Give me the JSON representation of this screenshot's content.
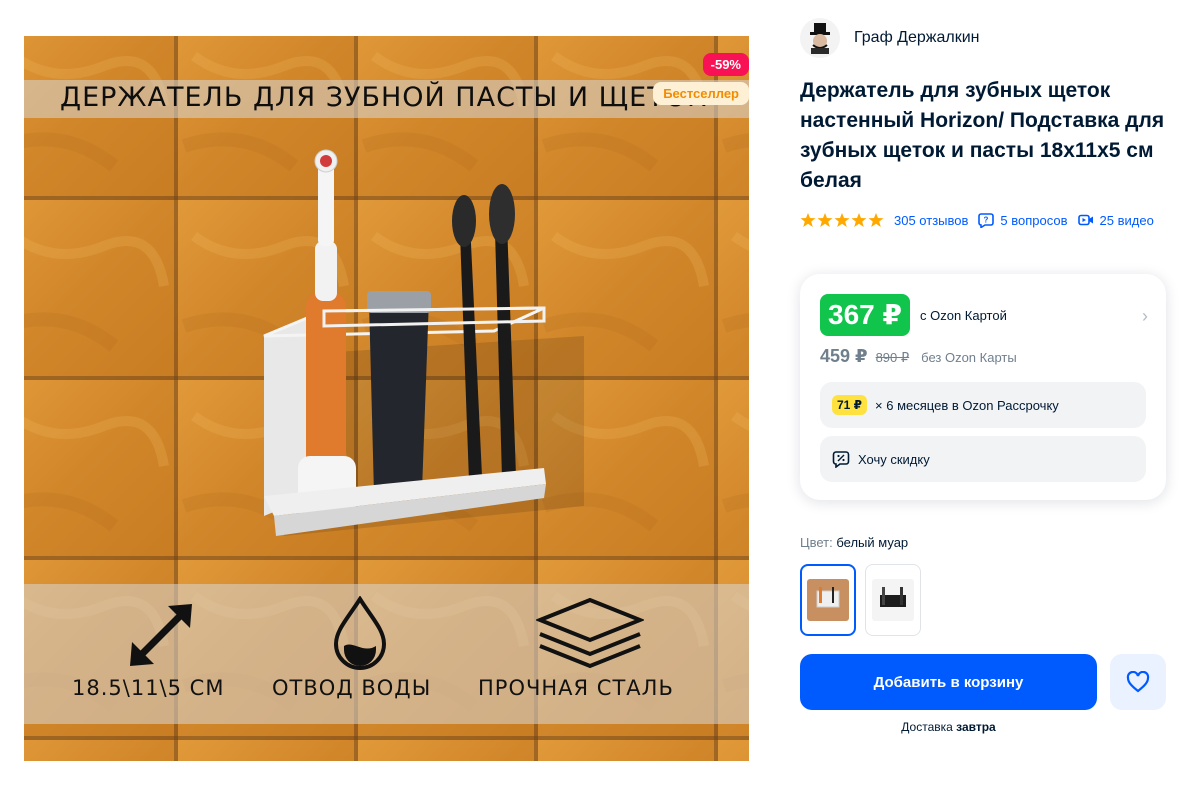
{
  "gallery": {
    "discount_badge": "-59%",
    "bestseller_badge": "Бестселлер",
    "image_title": "ДЕРЖАТЕЛЬ ДЛЯ ЗУБНОЙ ПАСТЫ И ЩЕТОК",
    "features": [
      {
        "label": "18.5\\11\\5 СМ",
        "icon": "diagonal-arrows-icon"
      },
      {
        "label": "ОТВОД ВОДЫ",
        "icon": "water-drop-icon"
      },
      {
        "label": "ПРОЧНАЯ СТАЛЬ",
        "icon": "steel-layers-icon"
      }
    ]
  },
  "seller": {
    "name": "Граф Держалкин"
  },
  "product": {
    "title": "Держатель для зубных щеток настенный Horizon/ Подставка для зубных щеток и пасты 18х11х5 см белая"
  },
  "meta": {
    "rating_stars": 5,
    "reviews": "305 отзывов",
    "questions": "5 вопросов",
    "videos": "25 видео"
  },
  "price": {
    "card_price": "367 ₽",
    "card_label": "с Ozon Картой",
    "price_no_card": "459 ₽",
    "old_price": "890 ₽",
    "no_card_label": "без Ozon Карты",
    "installment_amount": "71 ₽",
    "installment_text": "× 6 месяцев в Ozon Рассрочку",
    "discount_request": "Хочу скидку"
  },
  "color": {
    "label": "Цвет:",
    "value": "белый муар"
  },
  "actions": {
    "add_to_cart": "Добавить в корзину",
    "delivery_prefix": "Доставка",
    "delivery_when": "завтра"
  },
  "colors": {
    "accent": "#005bff",
    "price_green": "#10c44c",
    "discount_red": "#f91155",
    "star": "#ffa800"
  }
}
